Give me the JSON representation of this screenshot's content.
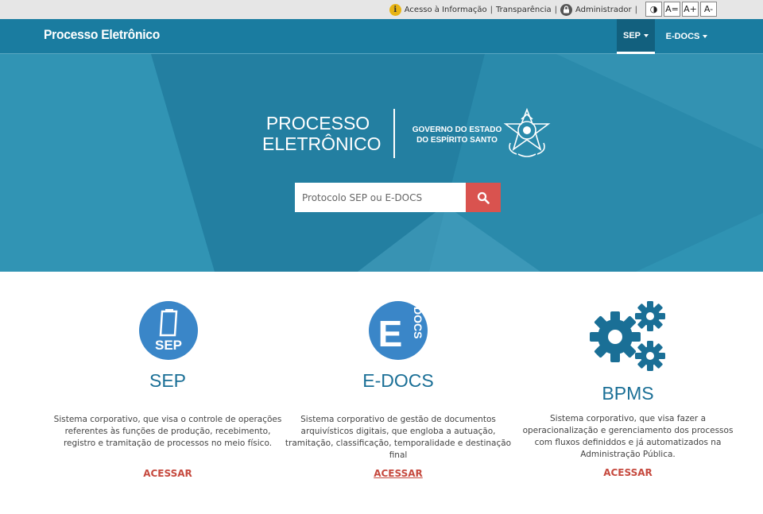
{
  "topbar": {
    "access_info": "Acesso à Informação",
    "transparency": "Transparência",
    "admin": "Administrador",
    "separator": "|",
    "contrast_label": "◑",
    "font_reset": "A=",
    "font_increase": "A+",
    "font_decrease": "A-"
  },
  "navbar": {
    "brand": "Processo Eletrônico",
    "items": [
      {
        "label": "SEP"
      },
      {
        "label": "E-DOCS"
      }
    ]
  },
  "hero": {
    "title_line1": "PROCESSO",
    "title_line2": "ELETRÔNICO",
    "gov_line1": "GOVERNO DO ESTADO",
    "gov_line2": "DO ESPÍRITO SANTO",
    "search_placeholder": "Protocolo SEP ou E-DOCS"
  },
  "cards": [
    {
      "title": "SEP",
      "icon_text": "SEP",
      "description": "Sistema corporativo, que visa o controle de operações referentes às funções de produção, recebimento, registro e tramitação de processos no meio físico.",
      "link": "ACESSAR"
    },
    {
      "title": "E-DOCS",
      "icon_letter": "E",
      "icon_text": "DOCS",
      "description": "Sistema corporativo de gestão de documentos arquivísticos digitais, que engloba a autuação, tramitação, classificação, temporalidade e destinação final",
      "link": "ACESSAR"
    },
    {
      "title": "BPMS",
      "description": "Sistema corporativo, que visa fazer a operacionalização e gerenciamento dos processos com fluxos definiddos e já automatizados na Administração Pública.",
      "link": "ACESSAR"
    }
  ],
  "colors": {
    "primary": "#1a7ca0",
    "accent_red": "#d9534f",
    "title_blue": "#1a6f96",
    "link_red": "#c64a3f",
    "icon_blue": "#3a86c8"
  }
}
